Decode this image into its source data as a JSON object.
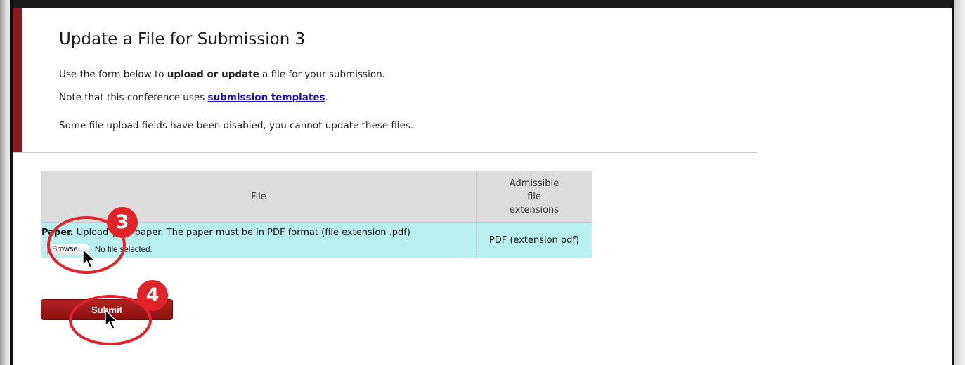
{
  "header": {
    "title": "Update a File for Submission 3",
    "line1": {
      "before": "Use the form below to ",
      "bold": "upload or update",
      "after": " a file for your submission."
    },
    "line2": {
      "before": "Note that this conference uses ",
      "link": "submission templates",
      "after": "."
    },
    "line3": "Some file upload fields have been disabled, you cannot update these files."
  },
  "table": {
    "col_file": "File",
    "col_ext_line1": "Admissible",
    "col_ext_line2": "file",
    "col_ext_line3": "extensions",
    "row": {
      "label": "Paper.",
      "description": " Upload your paper. The paper must be in PDF format (file extension .pdf)",
      "browse": "Browse...",
      "status": "No file selected.",
      "extension": "PDF (extension pdf)"
    }
  },
  "submit_label": "Submit",
  "annotations": {
    "step3": "3",
    "step4": "4"
  },
  "colors": {
    "accent": "#8b1a1a",
    "table_header": "#dcdcdc",
    "table_row": "#b9f0ef",
    "link": "#1a0dbb",
    "annotation": "#e0242a"
  }
}
